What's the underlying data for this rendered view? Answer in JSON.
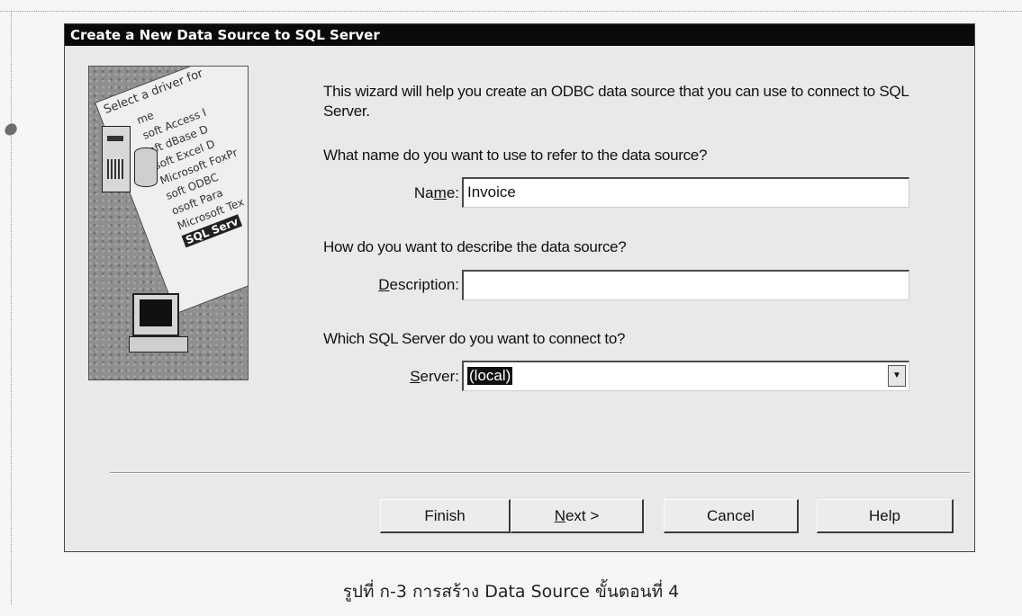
{
  "window": {
    "title": "Create a New Data Source to SQL Server"
  },
  "illustration": {
    "caption": "Select a driver for",
    "list_items": [
      "me",
      "soft Access I",
      "oft dBase D",
      "soft Excel D",
      "Microsoft FoxPr",
      "soft ODBC",
      "osoft Para",
      "Microsoft Tex"
    ],
    "selected_item": "SQL Serv"
  },
  "wizard": {
    "intro": "This wizard will help you create an ODBC data source that you can use to connect to SQL Server.",
    "name_question": "What name do you want to use to refer to the data source?",
    "name_label": "Name:",
    "name_value": "Invoice",
    "description_question": "How do you want to describe the data source?",
    "description_label": "Description:",
    "description_value": "",
    "server_question": "Which SQL Server do you want to connect to?",
    "server_label": "Server:",
    "server_value": "(local)"
  },
  "buttons": {
    "finish": "Finish",
    "next": "Next >",
    "cancel": "Cancel",
    "help": "Help"
  },
  "caption": "รูปที่ ก-3 การสร้าง Data Source ขั้นตอนที่ 4"
}
